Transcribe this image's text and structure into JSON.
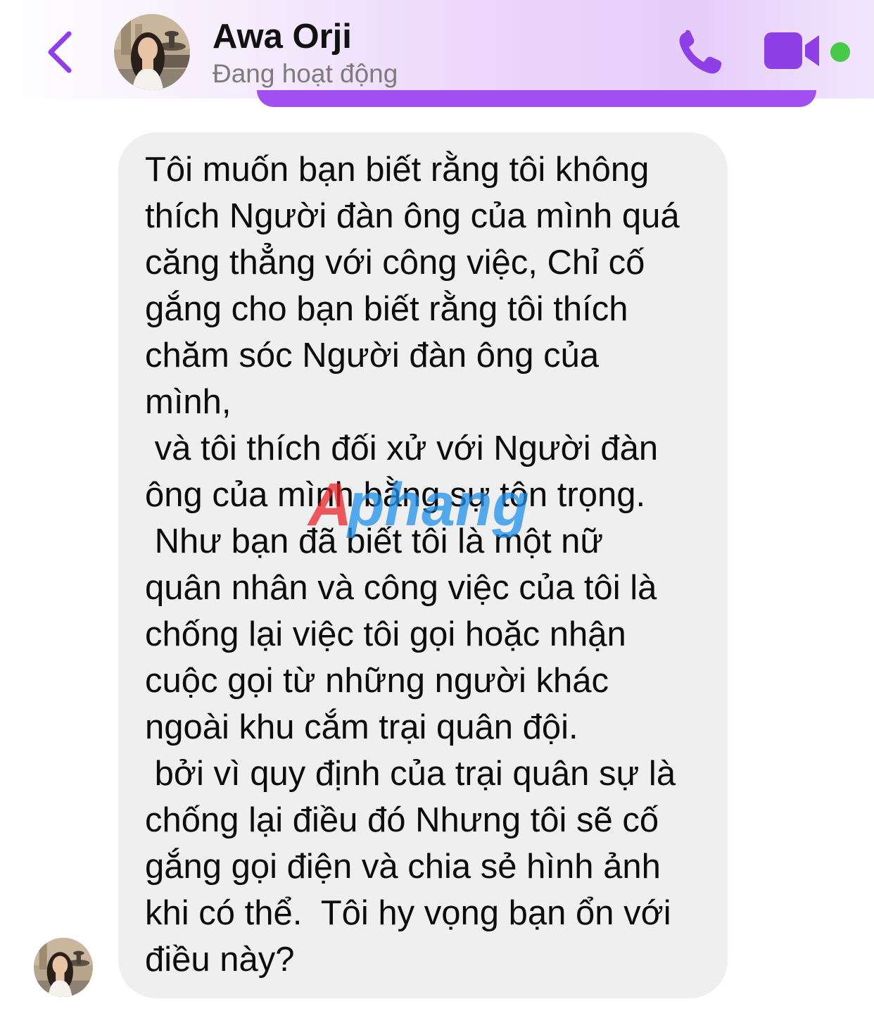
{
  "header": {
    "back_icon": "chevron-left-icon",
    "contact_name": "Awa Orji",
    "status": "Đang hoạt động",
    "call_icon": "phone-icon",
    "video_icon": "video-camera-icon",
    "online_indicator_color": "#47c94a",
    "accent_color": "#a24ff0"
  },
  "message": {
    "text": "Tôi muốn bạn biết rằng tôi không\nthích Người đàn ông của mình quá\ncăng thẳng với công việc, Chỉ cố\ngắng cho bạn biết rằng tôi thích\nchăm sóc Người đàn ông của\nmình,\n và tôi thích đối xử với Người đàn\nông của mình bằng sự tôn trọng.\n Như bạn đã biết tôi là một nữ\nquân nhân và công việc của tôi là\nchống lại việc tôi gọi hoặc nhận\ncuộc gọi từ những người khác\nngoài khu cắm trại quân đội.\n bởi vì quy định của trại quân sự là\nchống lại điều đó Nhưng tôi sẽ cố\ngắng gọi điện và chia sẻ hình ảnh\nkhi có thể.  Tôi hy vọng bạn ổn với\nđiều này?",
    "bubble_color": "#efefef"
  },
  "watermark": {
    "text": "Aphang",
    "colors": [
      "#e8262b",
      "#1e90e8"
    ]
  }
}
